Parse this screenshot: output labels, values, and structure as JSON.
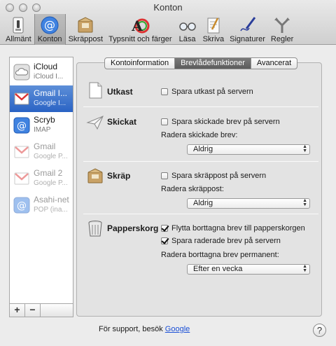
{
  "window": {
    "title": "Konton"
  },
  "toolbar": {
    "items": [
      {
        "label": "Allmänt",
        "icon": "switch-icon"
      },
      {
        "label": "Konton",
        "icon": "at-sign-icon"
      },
      {
        "label": "Skräppost",
        "icon": "junk-mail-icon"
      },
      {
        "label": "Typsnitt och färger",
        "icon": "fonts-colors-icon"
      },
      {
        "label": "Läsa",
        "icon": "glasses-icon"
      },
      {
        "label": "Skriva",
        "icon": "pen-paper-icon"
      },
      {
        "label": "Signaturer",
        "icon": "signature-pen-icon"
      },
      {
        "label": "Regler",
        "icon": "rules-icon"
      }
    ],
    "active": "Konton"
  },
  "accounts": [
    {
      "name": "iCloud",
      "type": "iCloud I...",
      "icon": "cloud-icon",
      "state": "normal"
    },
    {
      "name": "Gmail I...",
      "type": "Google I...",
      "icon": "gmail-icon",
      "state": "selected"
    },
    {
      "name": "Scryb",
      "type": "IMAP",
      "icon": "at-sign-icon",
      "state": "normal"
    },
    {
      "name": "Gmail",
      "type": "Google P...",
      "icon": "gmail-icon",
      "state": "disabled"
    },
    {
      "name": "Gmail 2",
      "type": "Google P...",
      "icon": "gmail-icon",
      "state": "disabled"
    },
    {
      "name": "Asahi-net",
      "type": "POP (ina...",
      "icon": "at-sign-icon",
      "state": "disabled"
    }
  ],
  "account_buttons": {
    "add": "+",
    "remove": "−"
  },
  "tabs": [
    {
      "label": "Kontoinformation",
      "active": false
    },
    {
      "label": "Brevlådefunktioner",
      "active": true
    },
    {
      "label": "Avancerat",
      "active": false
    }
  ],
  "sections": {
    "drafts": {
      "title": "Utkast",
      "checkbox": {
        "label": "Spara utkast på servern",
        "checked": false
      }
    },
    "sent": {
      "title": "Skickat",
      "checkbox": {
        "label": "Spara skickade brev på servern",
        "checked": false
      },
      "delete_label": "Radera skickade brev:",
      "delete_value": "Aldrig"
    },
    "junk": {
      "title": "Skräp",
      "checkbox": {
        "label": "Spara skräppost på servern",
        "checked": false
      },
      "delete_label": "Radera skräppost:",
      "delete_value": "Aldrig"
    },
    "trash": {
      "title": "Papperskorg",
      "checkbox_move": {
        "label": "Flytta borttagna brev till papperskorgen",
        "checked": true
      },
      "checkbox_save": {
        "label": "Spara raderade brev på servern",
        "checked": true
      },
      "delete_label": "Radera borttagna brev permanent:",
      "delete_value": "Efter en vecka"
    }
  },
  "support": {
    "prefix": "För support, besök",
    "link": "Google"
  },
  "help": {
    "label": "?"
  },
  "colors": {
    "selection": "#2a63c4",
    "link": "#1a4fd6",
    "panel": "#e3e3e3"
  }
}
